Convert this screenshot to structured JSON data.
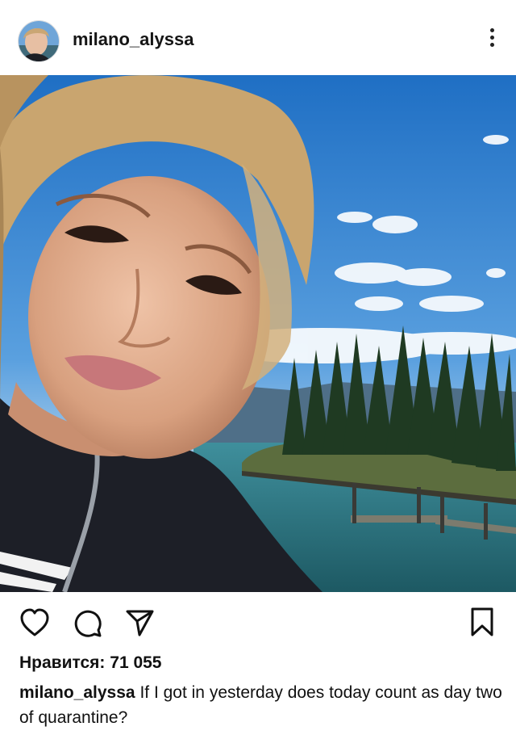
{
  "post": {
    "username": "milano_alyssa",
    "likes_label": "Нравится: 71 055",
    "caption_author": "milano_alyssa",
    "caption_text": "If I got in yesterday does today count as day two of quarantine?"
  },
  "icons": {
    "more": "more-vertical-icon",
    "like": "heart-icon",
    "comment": "comment-icon",
    "share": "send-icon",
    "save": "bookmark-icon"
  },
  "colors": {
    "text": "#111111",
    "background": "#ffffff",
    "sky": "#3d8bd6",
    "water": "#2f7f8c"
  }
}
